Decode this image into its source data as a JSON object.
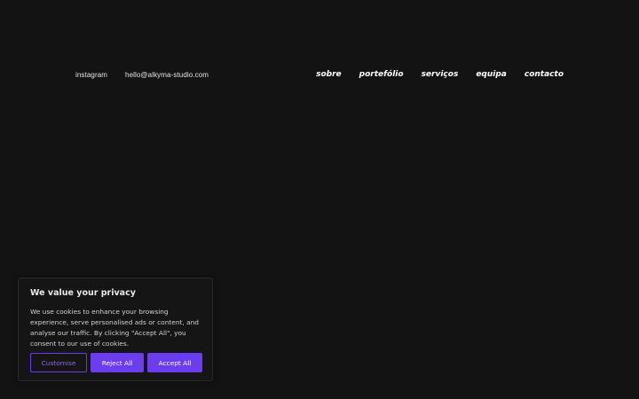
{
  "header": {
    "left_links": [
      {
        "label": "instagram"
      },
      {
        "label": "hello@alkyma-studio.com"
      }
    ],
    "nav": [
      {
        "label": "sobre"
      },
      {
        "label": "portefólio"
      },
      {
        "label": "serviços"
      },
      {
        "label": "equipa"
      },
      {
        "label": "contacto"
      }
    ]
  },
  "cookie_banner": {
    "title": "We value your privacy",
    "text": "We use cookies to enhance your browsing experience, serve personalised ads or content, and analyse our traffic. By clicking \"Accept All\", you consent to our use of cookies.",
    "customise_label": "Customise",
    "reject_label": "Reject All",
    "accept_label": "Accept All"
  },
  "colors": {
    "background": "#131314",
    "accent": "#6c3cf0"
  }
}
